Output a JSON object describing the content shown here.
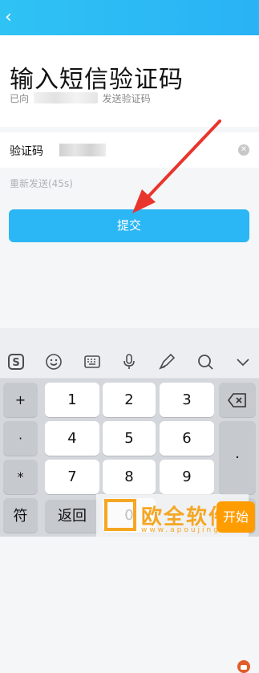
{
  "nav": {
    "back_icon": "chevron-left-icon"
  },
  "header": {
    "title": "输入短信验证码",
    "subtitle_prefix": "已向",
    "subtitle_suffix": "发送验证码"
  },
  "form": {
    "code_label": "验证码",
    "resend_text": "重新发送(45s)",
    "submit_label": "提交"
  },
  "keyboard": {
    "toolbar": [
      "sogou-logo-icon",
      "emoji-icon",
      "keyboard-icon",
      "microphone-icon",
      "pen-icon",
      "search-icon",
      "chevron-down-icon"
    ],
    "symbols": [
      "+",
      "·",
      "*",
      "#"
    ],
    "digits": [
      "1",
      "2",
      "3",
      "4",
      "5",
      "6",
      "7",
      "8",
      "9",
      "0"
    ],
    "right": [
      "backspace-icon",
      "·",
      "@"
    ],
    "bottom": {
      "fu": "符",
      "back": "返回",
      "start": "开始"
    }
  },
  "watermark": {
    "text": "欧全软件",
    "url": "www.apoujingcom"
  },
  "colors": {
    "accent": "#2bb6f5",
    "orange": "#ff9c00"
  }
}
